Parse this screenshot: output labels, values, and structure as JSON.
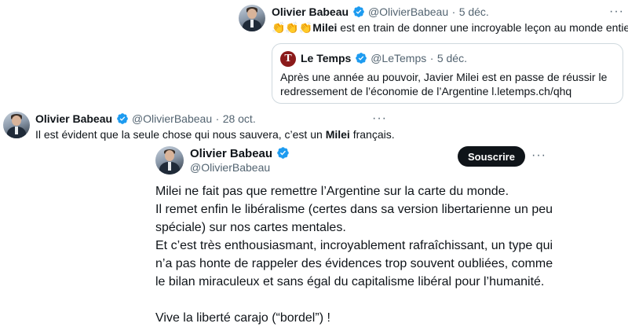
{
  "tweet1": {
    "name": "Olivier Babeau",
    "handle": "@OlivierBabeau",
    "dot": "·",
    "date": "5 déc.",
    "emojis": "👏👏👏",
    "bold_word": "Milei",
    "text_rest": " est en train de donner une incroyable leçon au monde entier.",
    "more": "···",
    "quote": {
      "logo_letter": "T",
      "name": "Le Temps",
      "handle": "@LeTemps",
      "dot": "·",
      "date": "5 déc.",
      "line1": "Après une année au pouvoir, Javier Milei est en passe de réussir le",
      "line2": "redressement de l’économie de l’Argentine l.letemps.ch/qhq"
    }
  },
  "tweet2": {
    "name": "Olivier Babeau",
    "handle": "@OlivierBabeau",
    "dot": "·",
    "date": "28 oct.",
    "more": "···",
    "text_before": "Il est évident que la seule chose qui nous sauvera, c’est un ",
    "bold_word": "Milei",
    "text_after": " français."
  },
  "embedded": {
    "name": "Olivier Babeau",
    "handle": "@OlivierBabeau",
    "subscribe_label": "Souscrire",
    "more": "···",
    "lines": [
      "Milei ne fait pas que remettre l’Argentine sur la carte du monde.",
      "Il remet enfin le libéralisme (certes dans sa version libertarienne un peu",
      "spéciale) sur nos cartes mentales.",
      "Et c’est très enthousiasmant, incroyablement rafraîchissant, un type qui",
      "n’a pas honte de rappeler des évidences trop souvent oubliées, comme",
      "le bilan miraculeux et sans égal du capitalisme libéral pour l’humanité.",
      "",
      "Vive la liberté carajo (“bordel”) !"
    ]
  },
  "colors": {
    "verified_blue": "#1d9bf0",
    "text": "#0f1419",
    "secondary": "#536471",
    "border": "#cfd9de"
  }
}
